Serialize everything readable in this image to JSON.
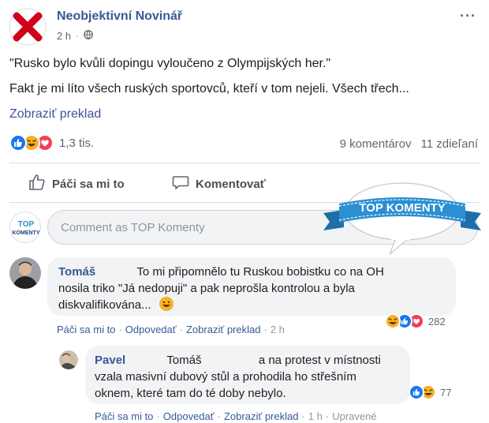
{
  "post": {
    "page_name": "Neobjektivní Novinář",
    "time": "2 h",
    "privacy_icon": "globe-icon",
    "text_line1": "\"Rusko bylo kvůli dopingu vyloučeno z Olympijských her.\"",
    "text_line2": "Fakt je mi líto všech ruských sportovců, kteří v tom nejeli. Všech třech...",
    "translate_label": "Zobraziť preklad"
  },
  "reactions": {
    "icons": [
      "like-icon",
      "haha-icon",
      "love-icon"
    ],
    "count": "1,3 tis.",
    "comments_count": "9 komentárov",
    "shares_count": "11 zdieľaní"
  },
  "actions": {
    "like_label": "Páči sa mi to",
    "comment_label": "Komentovať"
  },
  "badge": {
    "text": "TOP KOMENTY"
  },
  "composer": {
    "avatar_text_top": "TOP",
    "avatar_text_bottom": "KOMENTY",
    "placeholder": "Comment as TOP Komenty"
  },
  "comments": [
    {
      "author": "Tomáš",
      "line1": "To mi připomnělo tu Ruskou bobistku co na OH",
      "line2": "nosila triko \"Já nedopuji\" a pak neprošla kontrolou a byla",
      "line3": "diskvalifikována...",
      "emoji": "😀",
      "actions": {
        "like": "Páči sa mi to",
        "reply": "Odpovedať",
        "translate": "Zobraziť preklad",
        "time": "2 h"
      },
      "reaction_icons": [
        "haha-icon",
        "like-icon",
        "love-icon"
      ],
      "reaction_count": "282"
    },
    {
      "author": "Pavel",
      "mention": "Tomáš",
      "line1": "a na protest v místnosti",
      "line2": "vzala masivní dubový stůl a prohodila ho střešním",
      "line3": "oknem, které tam do té doby nebylo.",
      "actions": {
        "like": "Páči sa mi to",
        "reply": "Odpovedať",
        "translate": "Zobraziť preklad",
        "time": "1 h",
        "edited": "Upravené"
      },
      "reaction_icons": [
        "like-icon",
        "haha-icon"
      ],
      "reaction_count": "77"
    }
  ],
  "colors": {
    "link": "#385898",
    "like_blue": "#1877f2",
    "love_red": "#f33e58",
    "haha_yellow": "#f7b125",
    "badge_blue": "#2b8fd2"
  }
}
